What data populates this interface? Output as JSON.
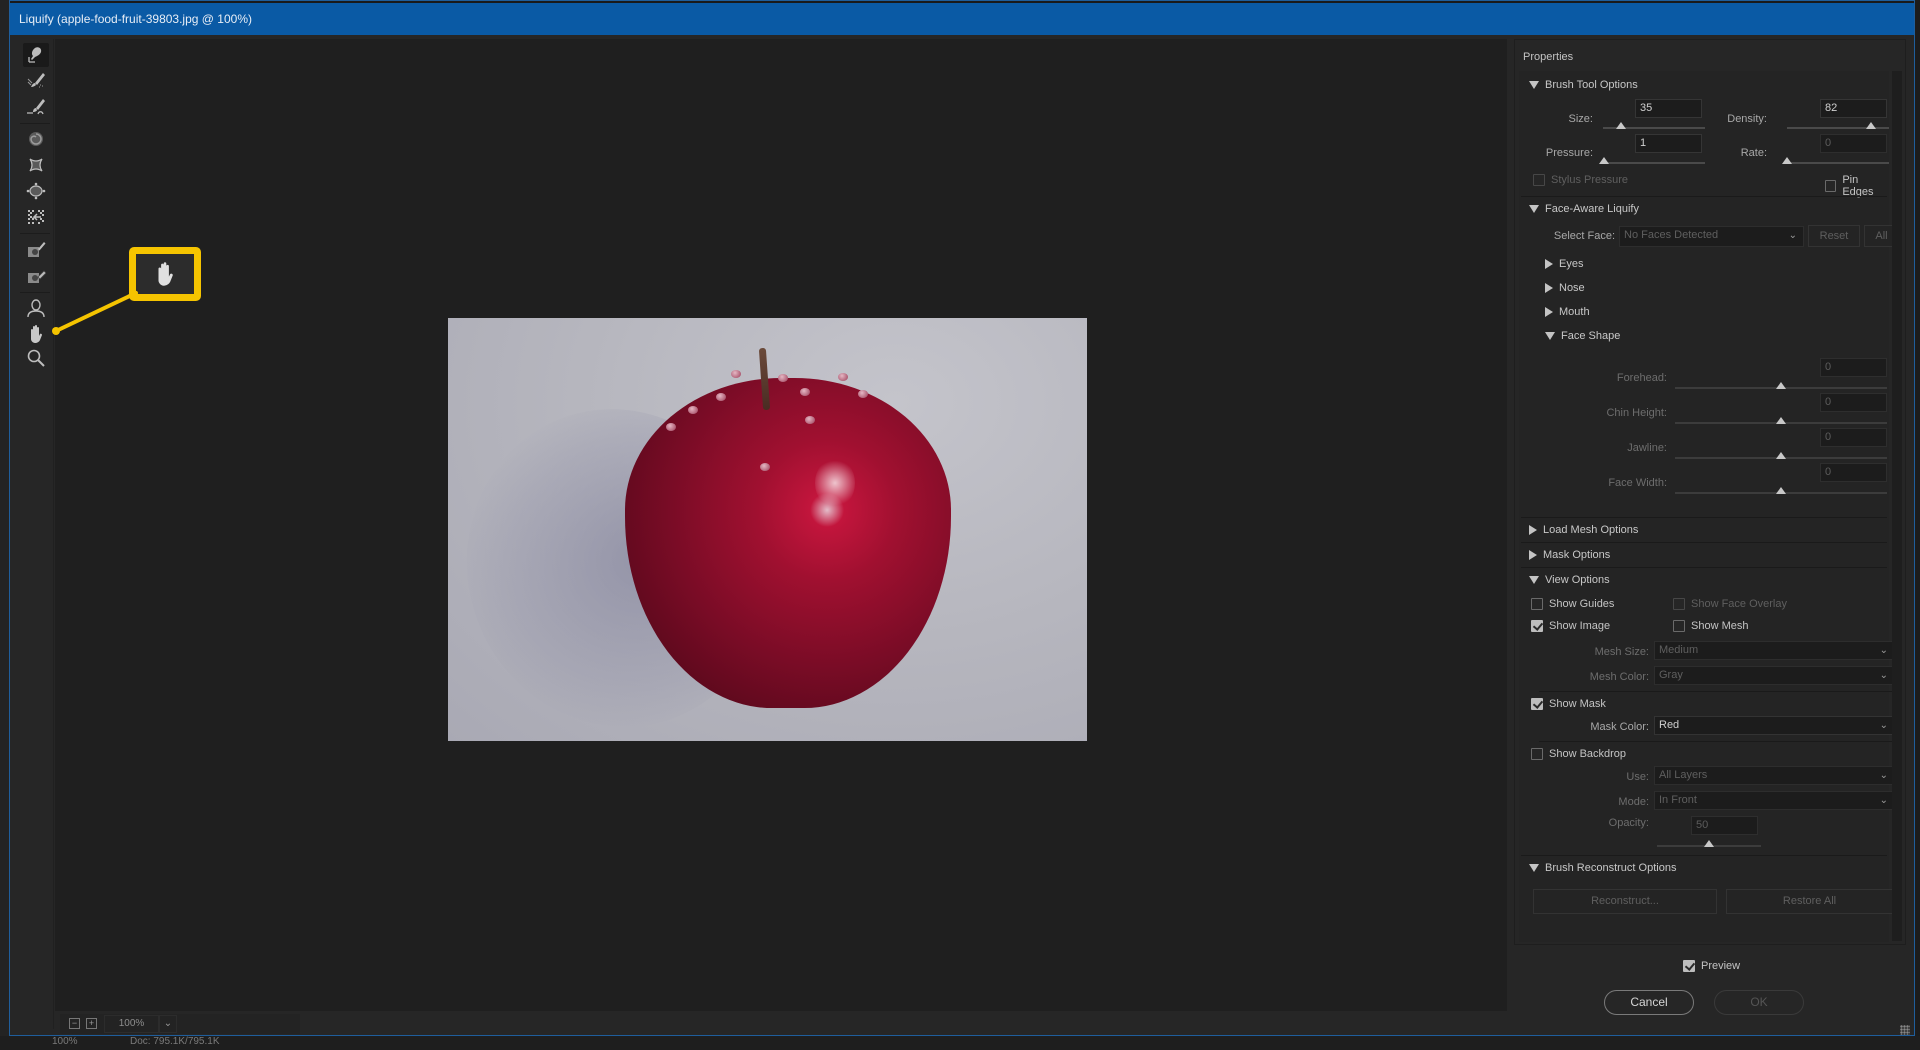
{
  "window": {
    "title": "Liquify (apple-food-fruit-39803.jpg @ 100%)",
    "accent_color": "#0a5aa5"
  },
  "background_status": {
    "zoom": "100%",
    "doc": "Doc: 795.1K/795.1K"
  },
  "toolbar": {
    "tools": [
      {
        "name": "forward-warp-tool",
        "icon": "warp-icon",
        "active": true
      },
      {
        "name": "reconstruct-tool",
        "icon": "reconstruct-brush-icon",
        "active": false
      },
      {
        "name": "smooth-tool",
        "icon": "smooth-brush-icon",
        "active": false
      },
      {
        "name": "twirl-clockwise-tool",
        "icon": "twirl-icon",
        "active": false
      },
      {
        "name": "pucker-tool",
        "icon": "pucker-icon",
        "active": false
      },
      {
        "name": "bloat-tool",
        "icon": "bloat-icon",
        "active": false
      },
      {
        "name": "push-left-tool",
        "icon": "push-left-icon",
        "active": false
      },
      {
        "name": "freeze-mask-tool",
        "icon": "freeze-mask-icon",
        "active": false
      },
      {
        "name": "thaw-mask-tool",
        "icon": "thaw-mask-icon",
        "active": false
      },
      {
        "name": "face-tool",
        "icon": "face-icon",
        "active": false
      },
      {
        "name": "hand-tool",
        "icon": "hand-icon",
        "active": false
      },
      {
        "name": "zoom-tool",
        "icon": "zoom-icon",
        "active": false
      }
    ]
  },
  "callout": {
    "highlight": "hand-icon",
    "color": "#f5c400"
  },
  "canvas": {
    "image_alt": "Red apple with water droplets on a light gray background",
    "zoom_value": "100%",
    "zoom_out_label": "−",
    "zoom_in_label": "+"
  },
  "properties": {
    "title": "Properties",
    "brush_tool_options": {
      "header": "Brush Tool Options",
      "size_label": "Size:",
      "size": "35",
      "size_pct": 0.18,
      "density_label": "Density:",
      "density": "82",
      "density_pct": 0.82,
      "pressure_label": "Pressure:",
      "pressure": "1",
      "pressure_pct": 0.01,
      "rate_label": "Rate:",
      "rate": "0",
      "rate_pct": 0.0,
      "stylus_pressure": "Stylus Pressure",
      "stylus_pressure_checked": false,
      "pin_edges": "Pin Edges",
      "pin_edges_checked": false
    },
    "face_aware": {
      "header": "Face-Aware Liquify",
      "select_face_label": "Select Face:",
      "select_face_value": "No Faces Detected",
      "reset_label": "Reset",
      "all_label": "All",
      "eyes": "Eyes",
      "nose": "Nose",
      "mouth": "Mouth",
      "face_shape": "Face Shape",
      "sliders": [
        {
          "label": "Forehead:",
          "value": "0",
          "pct": 0.5
        },
        {
          "label": "Chin Height:",
          "value": "0",
          "pct": 0.5
        },
        {
          "label": "Jawline:",
          "value": "0",
          "pct": 0.5
        },
        {
          "label": "Face Width:",
          "value": "0",
          "pct": 0.5
        }
      ]
    },
    "load_mesh": {
      "header": "Load Mesh Options"
    },
    "mask_options": {
      "header": "Mask Options"
    },
    "view_options": {
      "header": "View Options",
      "show_guides": "Show Guides",
      "show_guides_checked": false,
      "show_face_overlay": "Show Face Overlay",
      "show_face_overlay_checked": false,
      "show_image": "Show Image",
      "show_image_checked": true,
      "show_mesh": "Show Mesh",
      "show_mesh_checked": false,
      "mesh_size_label": "Mesh Size:",
      "mesh_size": "Medium",
      "mesh_color_label": "Mesh Color:",
      "mesh_color": "Gray",
      "show_mask": "Show Mask",
      "show_mask_checked": true,
      "mask_color_label": "Mask Color:",
      "mask_color": "Red",
      "show_backdrop": "Show Backdrop",
      "show_backdrop_checked": false,
      "use_label": "Use:",
      "use": "All Layers",
      "mode_label": "Mode:",
      "mode": "In Front",
      "opacity_label": "Opacity:",
      "opacity": "50",
      "opacity_pct": 0.5
    },
    "brush_reconstruct": {
      "header": "Brush Reconstruct Options",
      "reconstruct_label": "Reconstruct...",
      "restore_all_label": "Restore All"
    }
  },
  "footer": {
    "preview_label": "Preview",
    "preview_checked": true,
    "cancel_label": "Cancel",
    "ok_label": "OK"
  }
}
